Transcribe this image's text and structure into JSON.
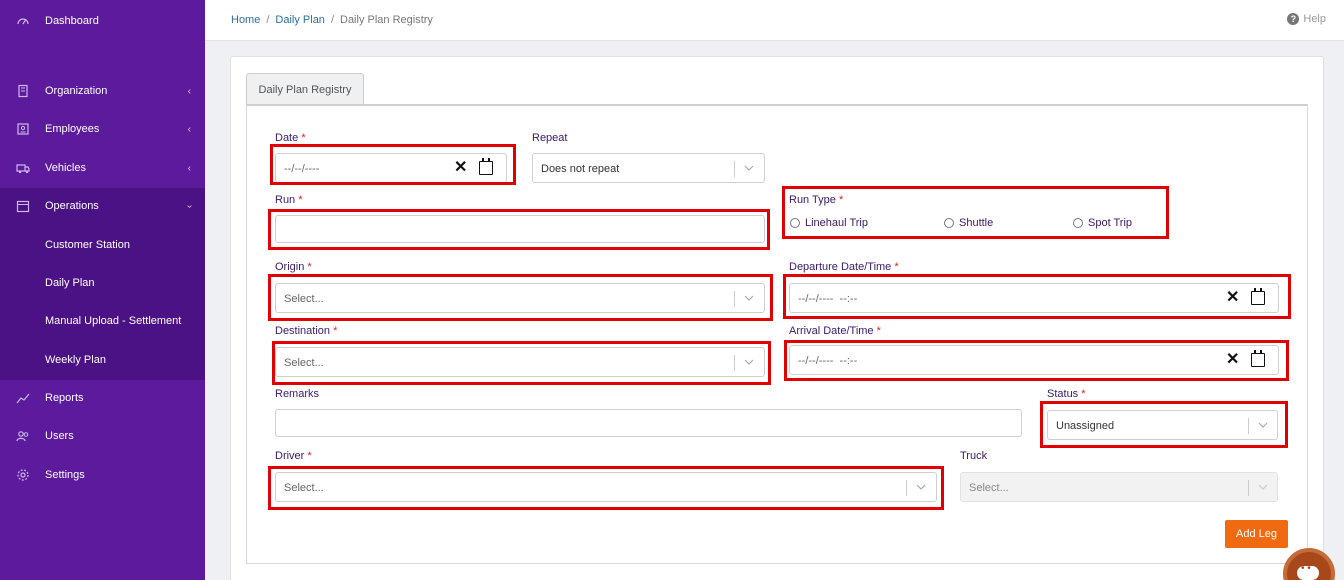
{
  "sidebar": {
    "items": [
      {
        "label": "Dashboard",
        "icon": "dashboard-icon"
      },
      {
        "label": "Organization",
        "icon": "building-icon"
      },
      {
        "label": "Employees",
        "icon": "id-card-icon"
      },
      {
        "label": "Vehicles",
        "icon": "truck-icon"
      },
      {
        "label": "Operations",
        "icon": "calendar-icon"
      },
      {
        "label": "Reports",
        "icon": "chart-line-icon"
      },
      {
        "label": "Users",
        "icon": "users-icon"
      },
      {
        "label": "Settings",
        "icon": "gear-icon"
      }
    ],
    "sub_items": [
      {
        "label": "Customer Station"
      },
      {
        "label": "Daily Plan"
      },
      {
        "label": "Manual Upload - Settlement"
      },
      {
        "label": "Weekly Plan"
      }
    ]
  },
  "breadcrumb": {
    "home": "Home",
    "daily_plan": "Daily Plan",
    "current": "Daily Plan Registry",
    "sep": "/"
  },
  "help_label": "Help",
  "tab_label": "Daily Plan Registry",
  "form": {
    "required_mark": "*",
    "date": {
      "label": "Date",
      "placeholder": "--/--/----"
    },
    "repeat": {
      "label": "Repeat",
      "value": "Does not repeat"
    },
    "run": {
      "label": "Run",
      "value": ""
    },
    "run_type": {
      "label": "Run Type",
      "options": [
        "Linehaul Trip",
        "Shuttle",
        "Spot Trip"
      ]
    },
    "origin": {
      "label": "Origin",
      "placeholder": "Select..."
    },
    "departure": {
      "label": "Departure Date/Time",
      "placeholder": "--/--/----  --:--"
    },
    "destination": {
      "label": "Destination",
      "placeholder": "Select..."
    },
    "arrival": {
      "label": "Arrival Date/Time",
      "placeholder": "--/--/----  --:--"
    },
    "remarks": {
      "label": "Remarks",
      "value": ""
    },
    "status": {
      "label": "Status",
      "value": "Unassigned"
    },
    "driver": {
      "label": "Driver",
      "placeholder": "Select..."
    },
    "truck": {
      "label": "Truck",
      "placeholder": "Select..."
    },
    "add_leg_label": "Add Leg"
  },
  "colors": {
    "sidebar": "#5c1a9c",
    "sidebar_sub": "#4a1284",
    "accent": "#f26a10",
    "highlight": "#e00000"
  }
}
